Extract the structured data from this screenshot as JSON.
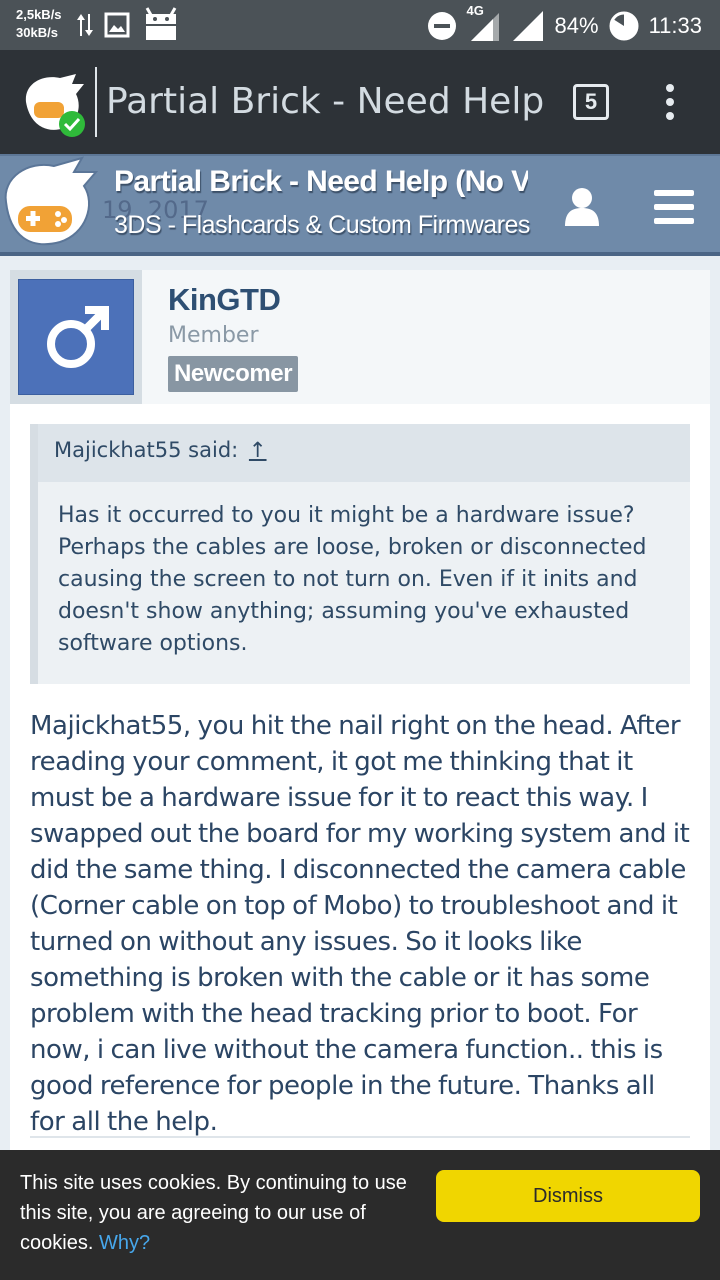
{
  "status_bar": {
    "upload_speed": "2,5kB/s",
    "download_speed": "30kB/s",
    "network": "4G",
    "battery": "84%",
    "time": "11:33",
    "icons": [
      "data-transfer-icon",
      "gallery-icon",
      "android-icon",
      "do-not-disturb-icon",
      "signal-icon",
      "battery-icon"
    ]
  },
  "browser": {
    "tab_title": "Partial Brick - Need Help (N",
    "tab_count": "5",
    "icons": [
      "site-favicon",
      "overflow-menu-icon"
    ]
  },
  "site_header": {
    "thread_title": "Partial Brick - Need Help (No Vi...",
    "forum_name": "3DS - Flashcards & Custom Firmwares",
    "faded_date": "19, 2017",
    "icons": [
      "site-logo",
      "user-icon",
      "hamburger-menu-icon"
    ]
  },
  "post": {
    "username": "KinGTD",
    "user_title": "Member",
    "badge": "Newcomer",
    "avatar_icon": "male-symbol-icon",
    "quote": {
      "author_line": "Majickhat55 said:",
      "arrow": "↑",
      "text": "Has it occurred to you it might be a hardware issue? Perhaps the cables are loose, broken or disconnected causing the screen to not turn on. Even if it inits and doesn't show anything; assuming you've exhausted software options."
    },
    "message": "Majickhat55, you hit the nail right on the head. After reading your comment, it got me thinking that it must be a hardware issue for it to react this way. I swapped out the board for my working system and it did the same thing. I disconnected the camera cable (Corner cable on top of Mobo) to troubleshoot and it turned on without any issues. So it looks like something is broken with the cable or it has some problem with the head tracking prior to boot. For now, i can live without the camera function.. this is good reference for people in the future. Thanks all for all the help."
  },
  "cookie_bar": {
    "text": "This site uses cookies. By continuing to use this site, you are agreeing to our use of cookies.",
    "why_link": "Why?",
    "dismiss_label": "Dismiss",
    "button_color": "#f0d600"
  }
}
